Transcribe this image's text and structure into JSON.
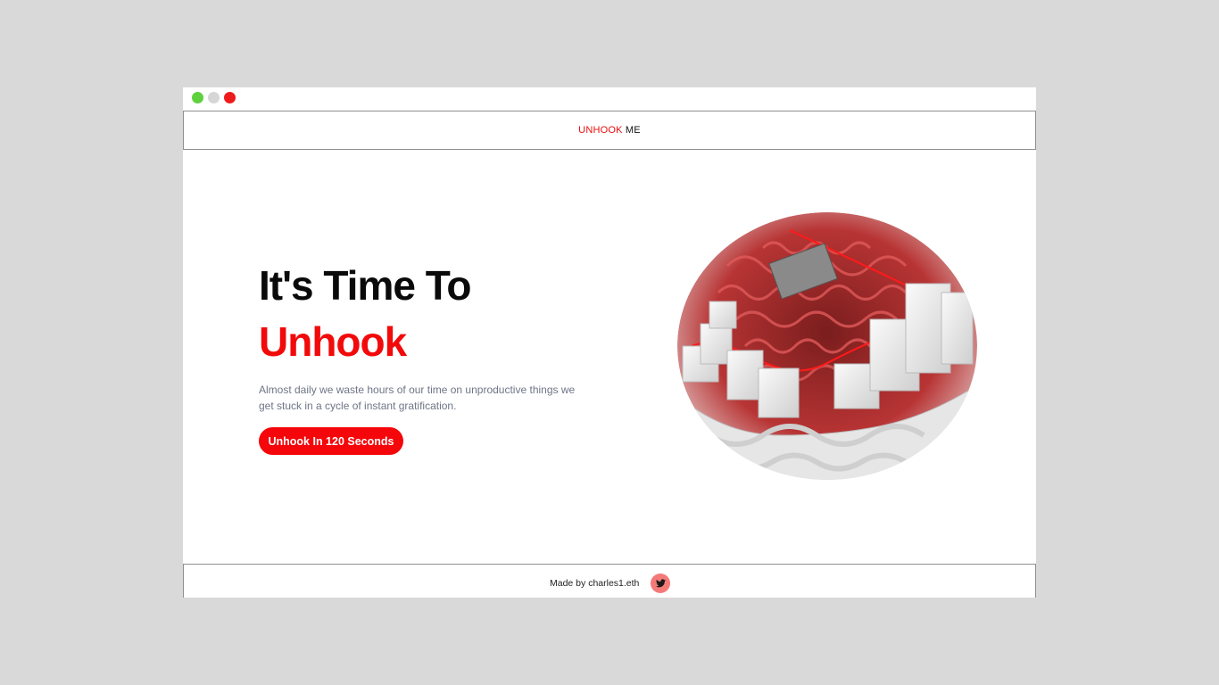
{
  "nav": {
    "brand_red": "UNHOOK",
    "brand_dark": " ME"
  },
  "hero": {
    "title": "It's Time To",
    "accent": "Unhook",
    "description": "Almost daily we waste hours of our time on unproductive things we get stuck in a cycle of instant gratification.",
    "cta_label": "Unhook In 120 Seconds"
  },
  "footer": {
    "credit": "Made by charles1.eth",
    "social_icon": "twitter-icon"
  },
  "colors": {
    "accent": "#f20a0a",
    "text": "#0a0a0a",
    "muted": "#6e7586",
    "twitter_bg": "#f47a78"
  },
  "window_controls": [
    "green",
    "gray",
    "red"
  ]
}
